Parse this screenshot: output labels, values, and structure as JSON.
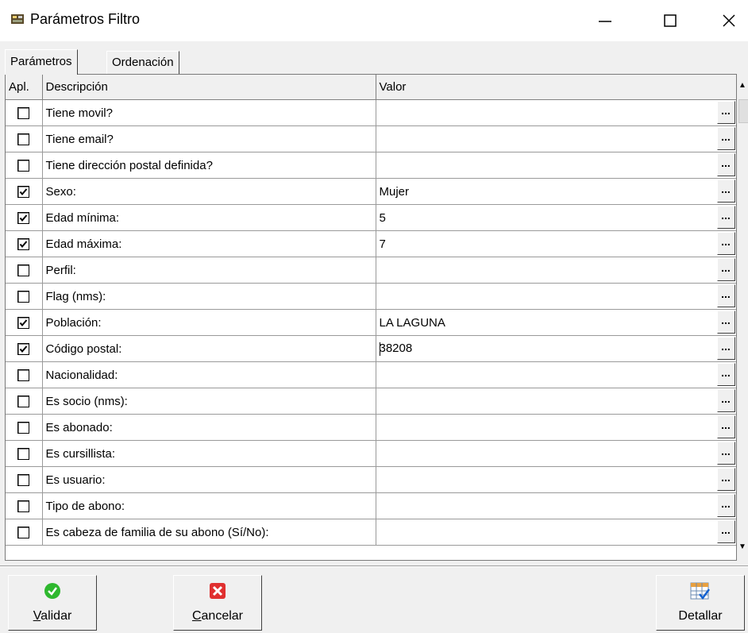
{
  "window": {
    "title": "Parámetros Filtro"
  },
  "tabs": [
    {
      "label": "Parámetros",
      "active": true
    },
    {
      "label": "Ordenación",
      "active": false
    }
  ],
  "grid": {
    "columns": [
      "Apl.",
      "Descripción",
      "Valor"
    ],
    "ellipsis_label": "...",
    "rows": [
      {
        "checked": false,
        "descripcion": "Tiene movil?",
        "valor": ""
      },
      {
        "checked": false,
        "descripcion": "Tiene email?",
        "valor": ""
      },
      {
        "checked": false,
        "descripcion": "Tiene dirección postal definida?",
        "valor": ""
      },
      {
        "checked": true,
        "descripcion": "Sexo:",
        "valor": "Mujer"
      },
      {
        "checked": true,
        "descripcion": "Edad mínima:",
        "valor": "5"
      },
      {
        "checked": true,
        "descripcion": "Edad máxima:",
        "valor": "7"
      },
      {
        "checked": false,
        "descripcion": "Perfil:",
        "valor": ""
      },
      {
        "checked": false,
        "descripcion": "Flag (nms):",
        "valor": ""
      },
      {
        "checked": true,
        "descripcion": "Población:",
        "valor": "LA LAGUNA"
      },
      {
        "checked": true,
        "descripcion": "Código postal:",
        "valor": "38208",
        "editing": true
      },
      {
        "checked": false,
        "descripcion": "Nacionalidad:",
        "valor": ""
      },
      {
        "checked": false,
        "descripcion": "Es socio (nms):",
        "valor": ""
      },
      {
        "checked": false,
        "descripcion": "Es abonado:",
        "valor": ""
      },
      {
        "checked": false,
        "descripcion": "Es cursillista:",
        "valor": ""
      },
      {
        "checked": false,
        "descripcion": "Es usuario:",
        "valor": ""
      },
      {
        "checked": false,
        "descripcion": "Tipo de abono:",
        "valor": ""
      },
      {
        "checked": false,
        "descripcion": "Es cabeza de familia de su abono (Sí/No):",
        "valor": ""
      }
    ]
  },
  "buttons": {
    "validar": {
      "mnemonic": "V",
      "rest": "alidar",
      "icon": "green-check-icon"
    },
    "cancelar": {
      "mnemonic": "C",
      "rest": "ancelar",
      "icon": "red-x-icon"
    },
    "detallar": {
      "label": "Detallar",
      "icon": "grid-check-icon"
    }
  },
  "colors": {
    "check_green": "#2eb82e",
    "cancel_red": "#e03030",
    "chrome": "#f0f0f0"
  }
}
